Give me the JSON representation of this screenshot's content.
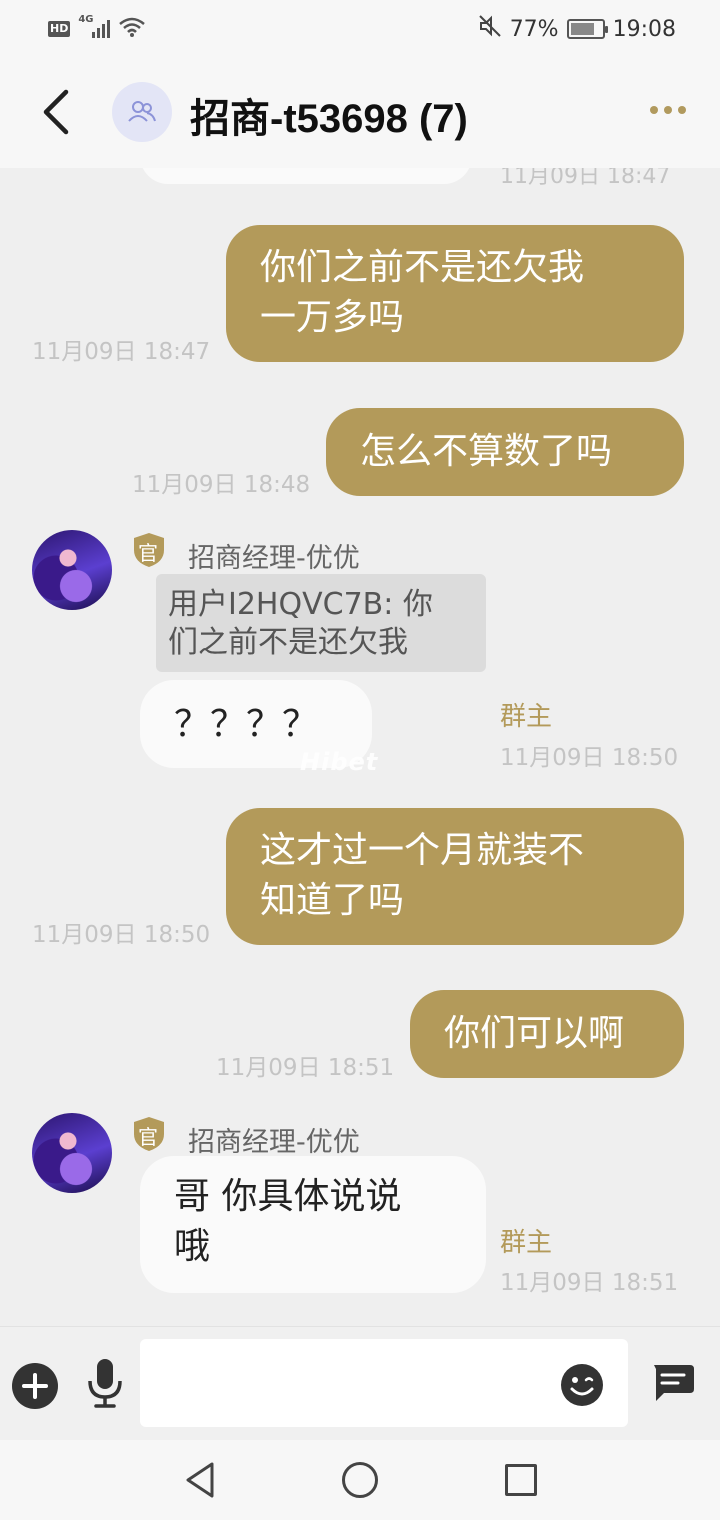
{
  "status": {
    "hd": "HD",
    "network": "4G",
    "battery": "77%",
    "battery_level": 0.77,
    "time": "19:08"
  },
  "header": {
    "title": "招商-t53698 (7)"
  },
  "messages": {
    "m0": {
      "time": "11月09日 18:47"
    },
    "m1": {
      "line1": "你们之前不是还欠我",
      "line2": "一万多吗",
      "time": "11月09日 18:47"
    },
    "m2": {
      "text": "怎么不算数了吗",
      "time": "11月09日 18:48"
    },
    "m3": {
      "badge": "官",
      "sender": "招商经理-优优",
      "quote_line1": "用户I2HQVC7B: 你",
      "quote_line2": "们之前不是还欠我",
      "text": "？？？？",
      "role": "群主",
      "time": "11月09日 18:50"
    },
    "m4": {
      "line1": "这才过一个月就装不",
      "line2": "知道了吗",
      "time": "11月09日 18:50"
    },
    "m5": {
      "text": "你们可以啊",
      "time": "11月09日 18:51"
    },
    "m6": {
      "badge": "官",
      "sender": "招商经理-优优",
      "line1": "哥 你具体说说",
      "line2": "哦",
      "role": "群主",
      "time": "11月09日 18:51"
    }
  },
  "watermark": "Hibet",
  "input": {
    "placeholder": ""
  },
  "colors": {
    "accent": "#b39a5a",
    "background": "#efefef"
  }
}
